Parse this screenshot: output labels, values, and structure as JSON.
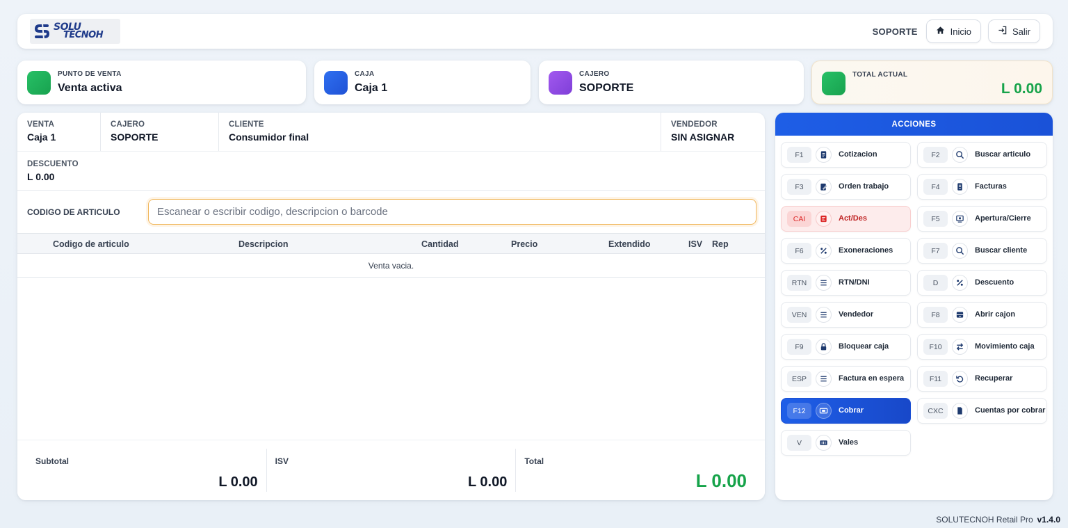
{
  "brand": {
    "line1": "SOLU",
    "line2": "TECNOH"
  },
  "header": {
    "user": "SOPORTE",
    "home_label": "Inicio",
    "exit_label": "Salir"
  },
  "colors": {
    "green": "#1eb35a",
    "blue": "#2464ec",
    "purple": "#9a4ae6",
    "accent": "#1e5ee6",
    "total_green": "#16a34a"
  },
  "info_cards": [
    {
      "label": "PUNTO DE VENTA",
      "value": "Venta activa"
    },
    {
      "label": "CAJA",
      "value": "Caja 1"
    },
    {
      "label": "CAJERO",
      "value": "SOPORTE"
    },
    {
      "label": "TOTAL ACTUAL",
      "value": "L 0.00"
    }
  ],
  "sale": {
    "meta": [
      {
        "label": "VENTA",
        "value": "Caja 1"
      },
      {
        "label": "CAJERO",
        "value": "SOPORTE"
      },
      {
        "label": "CLIENTE",
        "value": "Consumidor final"
      },
      {
        "label": "VENDEDOR",
        "value": "SIN ASIGNAR"
      }
    ],
    "discount": {
      "label": "DESCUENTO",
      "value": "L 0.00"
    },
    "code_label": "CODIGO DE ARTICULO",
    "code_placeholder": "Escanear o escribir codigo, descripcion o barcode",
    "columns": [
      "Codigo de articulo",
      "Descripcion",
      "Cantidad",
      "Precio",
      "Extendido",
      "ISV",
      "Rep"
    ],
    "empty_text": "Venta vacia.",
    "totals": [
      {
        "label": "Subtotal",
        "value": "L 0.00"
      },
      {
        "label": "ISV",
        "value": "L 0.00"
      },
      {
        "label": "Total",
        "value": "L 0.00"
      }
    ]
  },
  "actions": {
    "title": "ACCIONES",
    "items": [
      {
        "key": "F1",
        "label": "Cotizacion",
        "icon": "document-icon"
      },
      {
        "key": "F2",
        "label": "Buscar articulo",
        "icon": "search-icon"
      },
      {
        "key": "F3",
        "label": "Orden trabajo",
        "icon": "clipboard-edit-icon"
      },
      {
        "key": "F4",
        "label": "Facturas",
        "icon": "invoice-icon"
      },
      {
        "key": "CAI",
        "label": "Act/Des",
        "icon": "toggle-doc-icon"
      },
      {
        "key": "F5",
        "label": "Apertura/Cierre",
        "icon": "register-icon"
      },
      {
        "key": "F6",
        "label": "Exoneraciones",
        "icon": "percent-icon"
      },
      {
        "key": "F7",
        "label": "Buscar cliente",
        "icon": "search-icon"
      },
      {
        "key": "RTN",
        "label": "RTN/DNI",
        "icon": "menu-icon"
      },
      {
        "key": "D",
        "label": "Descuento",
        "icon": "percent-icon"
      },
      {
        "key": "VEN",
        "label": "Vendedor",
        "icon": "menu-icon"
      },
      {
        "key": "F8",
        "label": "Abrir cajon",
        "icon": "drawer-icon"
      },
      {
        "key": "F9",
        "label": "Bloquear caja",
        "icon": "lock-icon"
      },
      {
        "key": "F10",
        "label": "Movimiento caja",
        "icon": "swap-icon"
      },
      {
        "key": "ESP",
        "label": "Factura en espera",
        "icon": "menu-icon"
      },
      {
        "key": "F11",
        "label": "Recuperar",
        "icon": "undo-icon"
      },
      {
        "key": "F12",
        "label": "Cobrar",
        "icon": "cash-icon"
      },
      {
        "key": "CXC",
        "label": "Cuentas por cobrar",
        "icon": "receivable-icon"
      },
      {
        "key": "V",
        "label": "Vales",
        "icon": "voucher-icon"
      }
    ]
  },
  "footer": {
    "product": "SOLUTECNOH Retail Pro",
    "version": "v1.4.0"
  }
}
